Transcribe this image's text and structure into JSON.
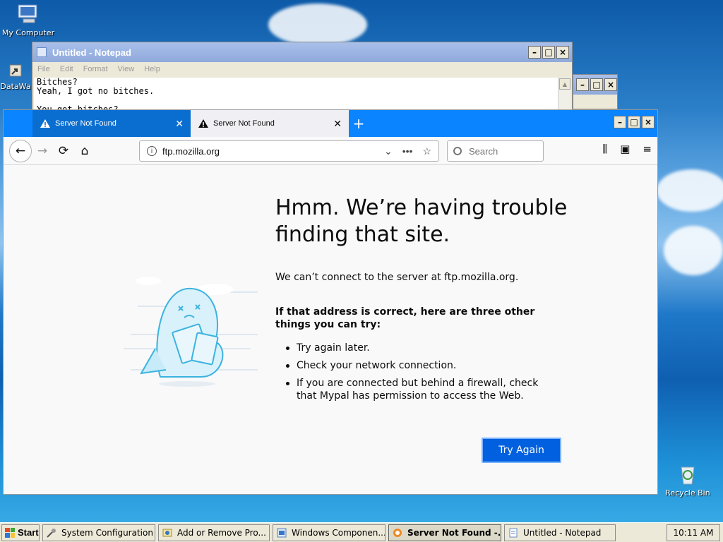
{
  "desktop": {
    "icons": [
      {
        "label": "My Computer"
      },
      {
        "label": "DataWa"
      },
      {
        "label": "Recycle Bin"
      }
    ]
  },
  "notepad": {
    "title": "Untitled - Notepad",
    "menu": [
      "File",
      "Edit",
      "Format",
      "View",
      "Help"
    ],
    "text": "Bitches?\nYeah, I got no bitches.\n\nYou got bitches?"
  },
  "browser": {
    "tabs": [
      {
        "label": "Server Not Found",
        "state": "background"
      },
      {
        "label": "Server Not Found",
        "state": "active"
      }
    ],
    "url": "ftp.mozilla.org",
    "search_placeholder": "Search",
    "error": {
      "title": "Hmm. We’re having trouble finding that site.",
      "description": "We can’t connect to the server at ftp.mozilla.org.",
      "try_heading": "If that address is correct, here are three other things you can try:",
      "suggestions": [
        "Try again later.",
        "Check your network connection.",
        "If you are connected but behind a firewall, check that Mypal has permission to access the Web."
      ],
      "button": "Try Again"
    }
  },
  "taskbar": {
    "start_label": "Start",
    "items": [
      {
        "label": "System Configuration"
      },
      {
        "label": "Add or Remove Pro..."
      },
      {
        "label": "Windows Componen..."
      },
      {
        "label": "Server Not Found -..."
      },
      {
        "label": "Untitled - Notepad"
      }
    ],
    "clock": "10:11 AM"
  },
  "colors": {
    "firefox_blue": "#0a84ff",
    "button_blue": "#0060df",
    "xp_title": "#8fa9dc",
    "taskbar": "#ece9d8"
  }
}
